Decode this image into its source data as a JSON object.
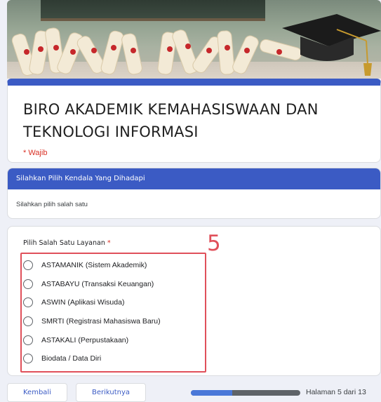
{
  "form": {
    "title": "BIRO AKADEMIK KEMAHASISWAAN DAN TEKNOLOGI INFORMASI",
    "required_note": "* Wajib"
  },
  "section": {
    "header": "Silahkan Pilih Kendala Yang Dihadapi",
    "description": "Silahkan pilih salah satu"
  },
  "question": {
    "title": "Pilih Salah Satu Layanan",
    "required_mark": "*",
    "options": [
      "ASTAMANIK (Sistem Akademik)",
      "ASTABAYU (Transaksi Keuangan)",
      "ASWIN (Aplikasi Wisuda)",
      "SMRTI (Registrasi Mahasiswa Baru)",
      "ASTAKALI (Perpustakaan)",
      "Biodata / Data Diri"
    ],
    "selected": null
  },
  "annotation": {
    "label": "5",
    "color": "#e0505a"
  },
  "footer": {
    "back_label": "Kembali",
    "next_label": "Berikutnya",
    "page_indicator": "Halaman 5 dari 13",
    "progress_fraction": 0.38
  },
  "theme": {
    "accent": "#3b5bc4",
    "required": "#d93025"
  }
}
